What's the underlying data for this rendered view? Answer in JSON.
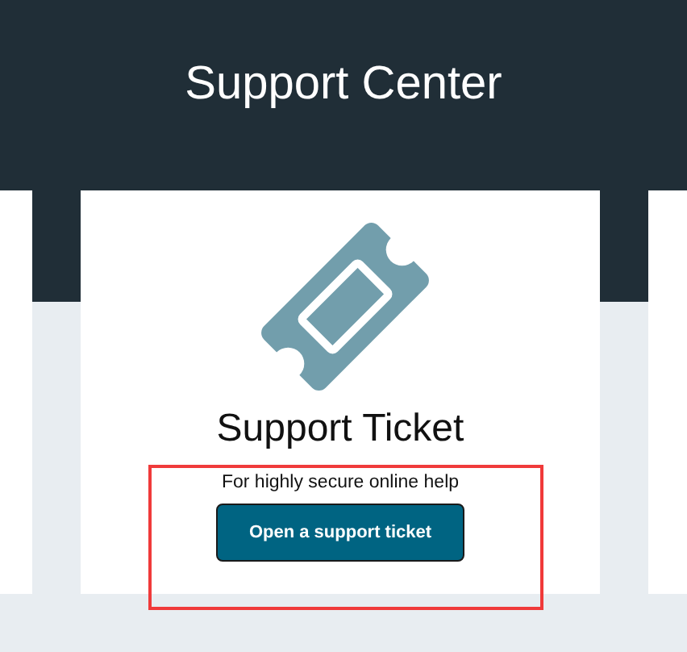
{
  "header": {
    "title": "Support Center"
  },
  "card": {
    "title": "Support Ticket",
    "description": "For highly secure online help",
    "button": "Open a support ticket"
  }
}
